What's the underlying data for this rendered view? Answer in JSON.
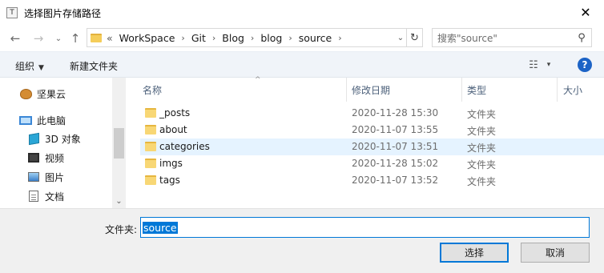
{
  "window": {
    "title": "选择图片存储路径",
    "app_icon_glyph": "T",
    "close_glyph": "✕"
  },
  "nav": {
    "back_glyph": "←",
    "forward_glyph": "→",
    "recent_glyph": "⌄",
    "up_glyph": "↑",
    "overflow_glyph": "«",
    "breadcrumbs": [
      "WorkSpace",
      "Git",
      "Blog",
      "blog",
      "source"
    ],
    "crumb_sep": "›",
    "dropdown_glyph": "⌄",
    "refresh_glyph": "↻",
    "search": {
      "placeholder": "搜索\"source\"",
      "icon_glyph": "⚲"
    }
  },
  "toolbar": {
    "organize_label": "组织",
    "organize_caret": "▼",
    "new_folder_label": "新建文件夹",
    "view_glyph": "☷",
    "view_dd_glyph": "▾",
    "help_glyph": "?"
  },
  "sidebar": {
    "items": [
      {
        "label": "坚果云"
      },
      {
        "label": "此电脑"
      },
      {
        "label": "3D 对象"
      },
      {
        "label": "视频"
      },
      {
        "label": "图片"
      },
      {
        "label": "文档"
      }
    ],
    "scroll_down_glyph": "⌄"
  },
  "columns": {
    "name": "名称",
    "modified": "修改日期",
    "type": "类型",
    "size": "大小",
    "sort_glyph": "^"
  },
  "files": [
    {
      "name": "_posts",
      "modified": "2020-11-28 15:30",
      "type": "文件夹"
    },
    {
      "name": "about",
      "modified": "2020-11-07 13:55",
      "type": "文件夹"
    },
    {
      "name": "categories",
      "modified": "2020-11-07 13:51",
      "type": "文件夹"
    },
    {
      "name": "imgs",
      "modified": "2020-11-28 15:02",
      "type": "文件夹"
    },
    {
      "name": "tags",
      "modified": "2020-11-07 13:52",
      "type": "文件夹"
    }
  ],
  "footer": {
    "folder_label": "文件夹:",
    "folder_value": "source",
    "select_label": "选择",
    "cancel_label": "取消"
  }
}
